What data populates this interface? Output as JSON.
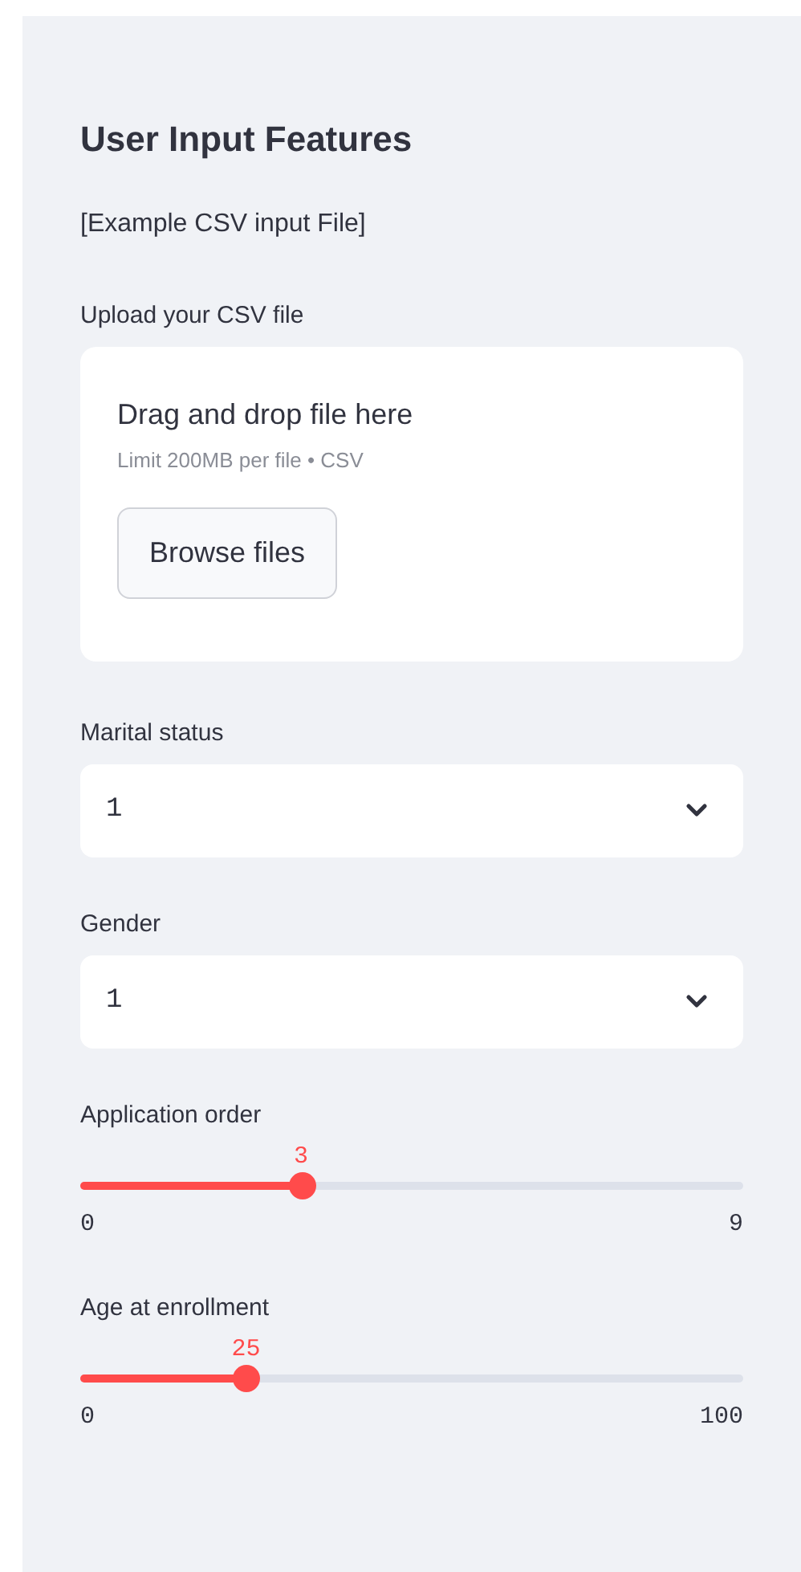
{
  "sidebar": {
    "title": "User Input Features",
    "example_link": "[Example CSV input File]",
    "uploader": {
      "label": "Upload your CSV file",
      "instructions": "Drag and drop file here",
      "limit": "Limit 200MB per file • CSV",
      "button": "Browse files"
    },
    "widgets": [
      {
        "kind": "select",
        "label": "Marital status",
        "value": "1"
      },
      {
        "kind": "select",
        "label": "Gender",
        "value": "1"
      },
      {
        "kind": "slider",
        "label": "Application order",
        "value": "3",
        "min": "0",
        "max": "9",
        "level": 0.333
      },
      {
        "kind": "slider",
        "label": "Age at enrollment",
        "value": "25",
        "min": "0",
        "max": "100",
        "level": 0.25
      }
    ]
  }
}
